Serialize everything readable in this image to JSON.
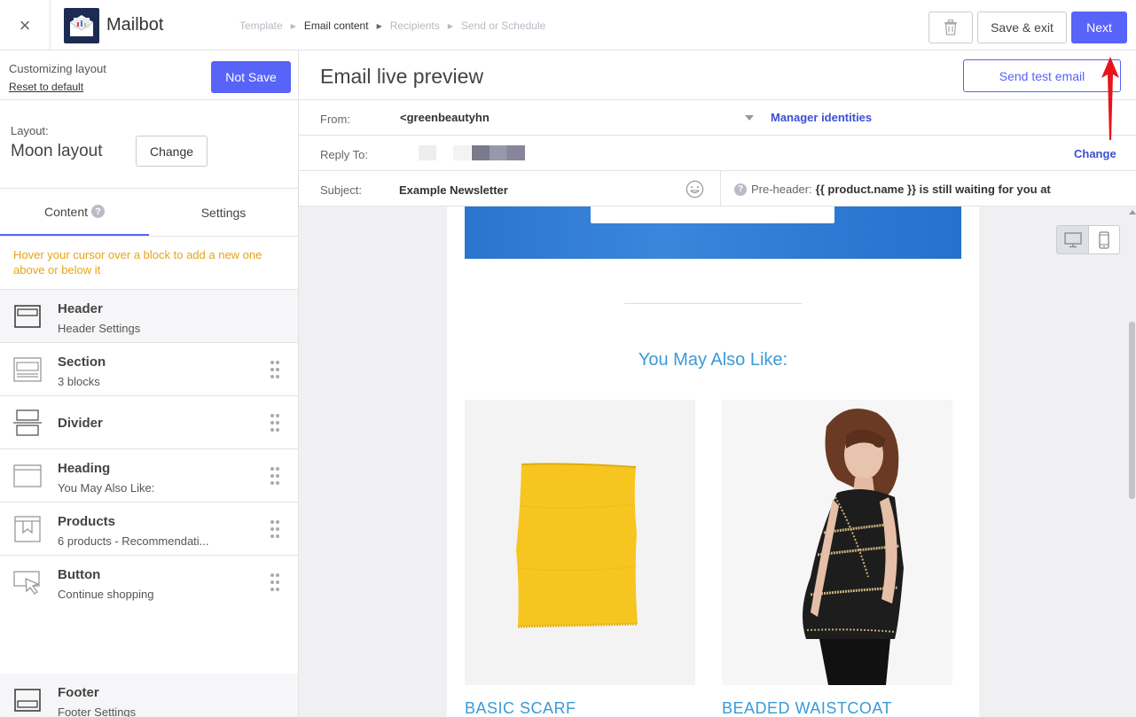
{
  "topbar": {
    "close_label": "×",
    "app_name": "Mailbot",
    "breadcrumb": [
      {
        "label": "Template",
        "active": false
      },
      {
        "label": "Email content",
        "active": true
      },
      {
        "label": "Recipients",
        "active": false
      },
      {
        "label": "Send or Schedule",
        "active": false
      }
    ],
    "save_exit_label": "Save & exit",
    "next_label": "Next"
  },
  "sidebar": {
    "customizing_label": "Customizing layout",
    "reset_label": "Reset to default",
    "not_save_label": "Not Save",
    "layout_label": "Layout:",
    "layout_name": "Moon layout",
    "change_label": "Change",
    "tabs": [
      {
        "label": "Content",
        "help": "?"
      },
      {
        "label": "Settings"
      }
    ],
    "hint": "Hover your cursor over a block to add a new one above or below it",
    "blocks": [
      {
        "title": "Header",
        "subtitle": "Header Settings",
        "icon": "header-block-icon"
      },
      {
        "title": "Section",
        "subtitle": "3 blocks",
        "icon": "section-block-icon"
      },
      {
        "title": "Divider",
        "subtitle": "",
        "icon": "divider-block-icon"
      },
      {
        "title": "Heading",
        "subtitle": "You May Also Like:",
        "icon": "heading-block-icon"
      },
      {
        "title": "Products",
        "subtitle": "6 products - Recommendati...",
        "icon": "products-block-icon"
      },
      {
        "title": "Button",
        "subtitle": "Continue shopping",
        "icon": "button-block-icon"
      },
      {
        "title": "Footer",
        "subtitle": "Footer Settings",
        "icon": "footer-block-icon"
      }
    ]
  },
  "preview": {
    "title": "Email live preview",
    "send_test_label": "Send test email",
    "from_label": "From:",
    "from_value": "<greenbeautyhn",
    "manager_identities_label": "Manager identities",
    "reply_to_label": "Reply To:",
    "reply_change_label": "Change",
    "subject_label": "Subject:",
    "subject_value": "Example Newsletter",
    "preheader_help": "?",
    "preheader_label": "Pre-header:",
    "preheader_value": "{{ product.name }} is still waiting for you at"
  },
  "email": {
    "heading": "You May Also Like:",
    "products": [
      {
        "name": "BASIC SCARF",
        "image": "yellow scarf"
      },
      {
        "name": "BEADED WAISTCOAT",
        "image": "model in black beaded waistcoat"
      }
    ]
  },
  "colors": {
    "accent": "#5863f8",
    "link": "#3c4fd6",
    "hint": "#e8a317",
    "email_heading": "#3a9ad9",
    "annotation_arrow": "#e8141b"
  }
}
